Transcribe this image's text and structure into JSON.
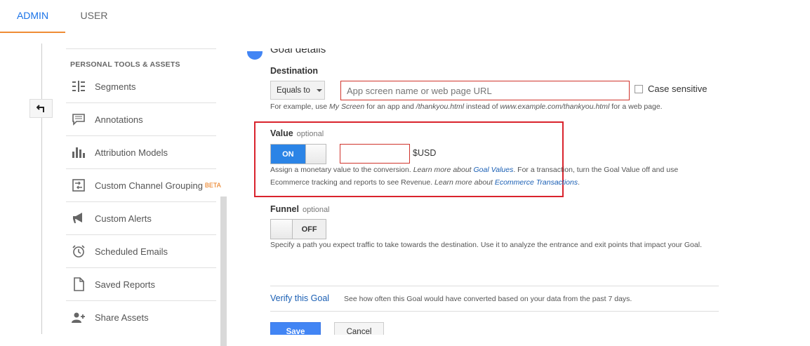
{
  "tabs": {
    "admin": "ADMIN",
    "user": "USER"
  },
  "sidebar": {
    "section_title": "PERSONAL TOOLS & ASSETS",
    "items": [
      {
        "label": "Segments",
        "icon": "segments-icon"
      },
      {
        "label": "Annotations",
        "icon": "annotations-icon"
      },
      {
        "label": "Attribution Models",
        "icon": "attribution-models-icon"
      },
      {
        "label": "Custom Channel Grouping",
        "icon": "channel-grouping-icon",
        "badge": "BETA"
      },
      {
        "label": "Custom Alerts",
        "icon": "megaphone-icon"
      },
      {
        "label": "Scheduled Emails",
        "icon": "alarm-clock-icon"
      },
      {
        "label": "Saved Reports",
        "icon": "document-icon"
      },
      {
        "label": "Share Assets",
        "icon": "add-person-icon"
      }
    ]
  },
  "goal": {
    "step_title": "Goal details",
    "destination": {
      "label": "Destination",
      "match_type": "Equals to",
      "placeholder": "App screen name or web page URL",
      "value": "",
      "case_sensitive_label": "Case sensitive",
      "case_sensitive_checked": false,
      "hint": {
        "p1": "For example, use ",
        "app_example": "My Screen",
        "p2": " for an app and ",
        "page_example": "/thankyou.html",
        "p3": " instead of ",
        "url_example": "www.example.com/thankyou.html",
        "p4": " for a web page."
      }
    },
    "value": {
      "label": "Value",
      "optional": "optional",
      "toggle": "ON",
      "amount": "",
      "currency": "$USD",
      "hint": {
        "p1": "Assign a monetary value to the conversion. ",
        "learn1": "Learn more about ",
        "link1": "Goal Values",
        "p2": ". For a transaction, turn the Goal Value off and use Ecommerce tracking and reports to see Revenue. ",
        "learn2": "Learn more about ",
        "link2": "Ecommerce Transactions",
        "p3": "."
      }
    },
    "funnel": {
      "label": "Funnel",
      "optional": "optional",
      "toggle": "OFF",
      "hint": "Specify a path you expect traffic to take towards the destination. Use it to analyze the entrance and exit points that impact your Goal."
    },
    "verify": {
      "link": "Verify this Goal",
      "desc": "See how often this Goal would have converted based on your data from the past 7 days."
    },
    "buttons": {
      "save": "Save",
      "cancel": "Cancel"
    }
  },
  "colors": {
    "accent": "#4285f4",
    "tab_underline": "#ef8c35",
    "highlight_border": "#d9232d",
    "link": "#1a5fb4"
  }
}
